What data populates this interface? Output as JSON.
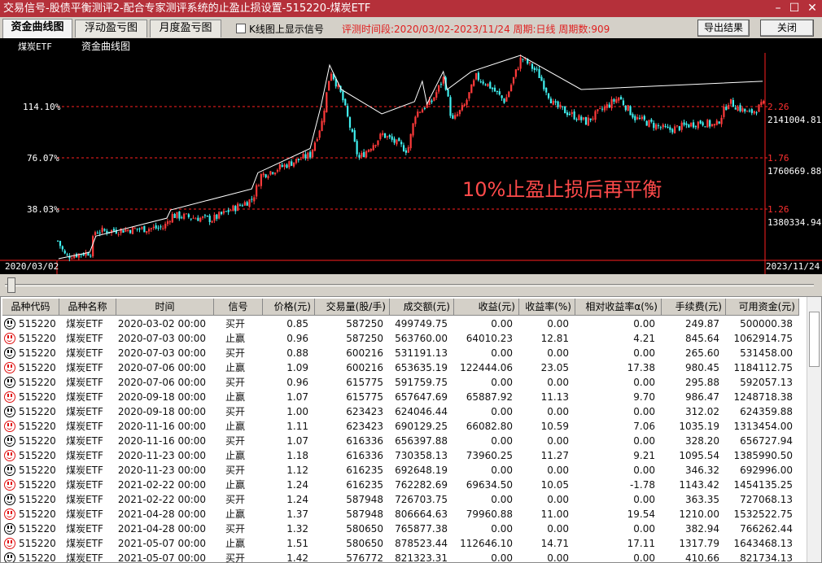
{
  "window": {
    "title": "交易信号-股债平衡测评2-配合专家测评系统的止盈止损设置-515220-煤炭ETF",
    "min": "–",
    "max": "☐",
    "close": "✕"
  },
  "toolbar": {
    "tabs": [
      "资金曲线图",
      "浮动盈亏图",
      "月度盈亏图"
    ],
    "checkbox_label": "K线图上显示信号",
    "checkbox_checked": false,
    "period_info": "评测时间段:2020/03/02-2023/11/24  周期:日线  周期数:909",
    "export_label": "导出结果",
    "close_label": "关闭"
  },
  "chart_data": {
    "type": "line",
    "security_label": "煤炭ETF",
    "title": "资金曲线图",
    "annotation": "10%止盈止损后再平衡",
    "start_date": "2020/03/02",
    "end_date": "2023/11/24",
    "bar_count": 909,
    "left_ticks": [
      "114.10%",
      "76.07%",
      "38.03%"
    ],
    "left_tick_values": [
      114.1,
      76.07,
      38.03
    ],
    "price_ticks": [
      "2.26",
      "1.76",
      "1.26"
    ],
    "price_tick_values": [
      2.26,
      1.76,
      1.26
    ],
    "equity_ticks": [
      "2141004.81",
      "1760669.88",
      "1380334.94"
    ],
    "colors": {
      "up": "#ff3a3a",
      "down": "#40f0f0",
      "equity": "#ffffff",
      "grid": "#ff2020"
    },
    "price_series": [
      [
        2,
        0.92
      ],
      [
        10,
        0.8
      ],
      [
        42,
        0.84
      ],
      [
        47,
        1.04
      ],
      [
        136,
        1.08
      ],
      [
        146,
        1.2
      ],
      [
        198,
        1.16
      ],
      [
        250,
        1.36
      ],
      [
        261,
        1.59
      ],
      [
        324,
        1.79
      ],
      [
        339,
        2.11
      ],
      [
        350,
        2.62
      ],
      [
        365,
        2.35
      ],
      [
        386,
        1.75
      ],
      [
        417,
        1.99
      ],
      [
        449,
        1.83
      ],
      [
        459,
        2.19
      ],
      [
        480,
        2.31
      ],
      [
        496,
        2.55
      ],
      [
        506,
        2.11
      ],
      [
        522,
        2.27
      ],
      [
        537,
        2.55
      ],
      [
        553,
        2.47
      ],
      [
        574,
        2.31
      ],
      [
        595,
        2.74
      ],
      [
        616,
        2.59
      ],
      [
        637,
        2.27
      ],
      [
        678,
        2.11
      ],
      [
        720,
        2.35
      ],
      [
        741,
        2.15
      ],
      [
        783,
        2.03
      ],
      [
        825,
        2.11
      ],
      [
        845,
        2.07
      ],
      [
        861,
        2.31
      ],
      [
        887,
        2.19
      ],
      [
        906,
        2.28
      ]
    ],
    "equity_pct_series": [
      [
        2,
        1.2
      ],
      [
        42,
        6
      ],
      [
        50,
        18
      ],
      [
        141,
        31.3
      ],
      [
        146,
        37.4
      ],
      [
        250,
        53
      ],
      [
        258,
        65
      ],
      [
        325,
        83
      ],
      [
        339,
        114.7
      ],
      [
        350,
        144.9
      ],
      [
        365,
        126.8
      ],
      [
        417,
        108.7
      ],
      [
        459,
        117.8
      ],
      [
        469,
        132.9
      ],
      [
        475,
        116
      ],
      [
        496,
        140.1
      ],
      [
        501,
        126.8
      ],
      [
        532,
        140.1
      ],
      [
        595,
        152.1
      ],
      [
        673,
        126.8
      ],
      [
        906,
        132.9
      ]
    ]
  },
  "table": {
    "columns": [
      "品种代码",
      "品种名称",
      "时间",
      "信号",
      "价格(元)",
      "交易量(股/手)",
      "成交额(元)",
      "收益(元)",
      "收益率(%)",
      "相对收益率α(%)",
      "手续费(元)",
      "可用资金(元)"
    ],
    "rows": [
      [
        "515220",
        "煤炭ETF",
        "2020-03-02 00:00",
        "买开",
        "0.85",
        "587250",
        "499749.75",
        "0.00",
        "0.00",
        "0.00",
        "249.87",
        "500000.38"
      ],
      [
        "515220",
        "煤炭ETF",
        "2020-07-03 00:00",
        "止赢",
        "0.96",
        "587250",
        "563760.00",
        "64010.23",
        "12.81",
        "4.21",
        "845.64",
        "1062914.75"
      ],
      [
        "515220",
        "煤炭ETF",
        "2020-07-03 00:00",
        "买开",
        "0.88",
        "600216",
        "531191.13",
        "0.00",
        "0.00",
        "0.00",
        "265.60",
        "531458.00"
      ],
      [
        "515220",
        "煤炭ETF",
        "2020-07-06 00:00",
        "止赢",
        "1.09",
        "600216",
        "653635.19",
        "122444.06",
        "23.05",
        "17.38",
        "980.45",
        "1184112.75"
      ],
      [
        "515220",
        "煤炭ETF",
        "2020-07-06 00:00",
        "买开",
        "0.96",
        "615775",
        "591759.75",
        "0.00",
        "0.00",
        "0.00",
        "295.88",
        "592057.13"
      ],
      [
        "515220",
        "煤炭ETF",
        "2020-09-18 00:00",
        "止赢",
        "1.07",
        "615775",
        "657647.69",
        "65887.92",
        "11.13",
        "9.70",
        "986.47",
        "1248718.38"
      ],
      [
        "515220",
        "煤炭ETF",
        "2020-09-18 00:00",
        "买开",
        "1.00",
        "623423",
        "624046.44",
        "0.00",
        "0.00",
        "0.00",
        "312.02",
        "624359.88"
      ],
      [
        "515220",
        "煤炭ETF",
        "2020-11-16 00:00",
        "止赢",
        "1.11",
        "623423",
        "690129.25",
        "66082.80",
        "10.59",
        "7.06",
        "1035.19",
        "1313454.00"
      ],
      [
        "515220",
        "煤炭ETF",
        "2020-11-16 00:00",
        "买开",
        "1.07",
        "616336",
        "656397.88",
        "0.00",
        "0.00",
        "0.00",
        "328.20",
        "656727.94"
      ],
      [
        "515220",
        "煤炭ETF",
        "2020-11-23 00:00",
        "止赢",
        "1.18",
        "616336",
        "730358.13",
        "73960.25",
        "11.27",
        "9.21",
        "1095.54",
        "1385990.50"
      ],
      [
        "515220",
        "煤炭ETF",
        "2020-11-23 00:00",
        "买开",
        "1.12",
        "616235",
        "692648.19",
        "0.00",
        "0.00",
        "0.00",
        "346.32",
        "692996.00"
      ],
      [
        "515220",
        "煤炭ETF",
        "2021-02-22 00:00",
        "止赢",
        "1.24",
        "616235",
        "762282.69",
        "69634.50",
        "10.05",
        "-1.78",
        "1143.42",
        "1454135.25"
      ],
      [
        "515220",
        "煤炭ETF",
        "2021-02-22 00:00",
        "买开",
        "1.24",
        "587948",
        "726703.75",
        "0.00",
        "0.00",
        "0.00",
        "363.35",
        "727068.13"
      ],
      [
        "515220",
        "煤炭ETF",
        "2021-04-28 00:00",
        "止赢",
        "1.37",
        "587948",
        "806664.63",
        "79960.88",
        "11.00",
        "19.54",
        "1210.00",
        "1532522.75"
      ],
      [
        "515220",
        "煤炭ETF",
        "2021-04-28 00:00",
        "买开",
        "1.32",
        "580650",
        "765877.38",
        "0.00",
        "0.00",
        "0.00",
        "382.94",
        "766262.44"
      ],
      [
        "515220",
        "煤炭ETF",
        "2021-05-07 00:00",
        "止赢",
        "1.51",
        "580650",
        "878523.44",
        "112646.10",
        "14.71",
        "17.11",
        "1317.79",
        "1643468.13"
      ],
      [
        "515220",
        "煤炭ETF",
        "2021-05-07 00:00",
        "买开",
        "1.42",
        "576772",
        "821323.31",
        "0.00",
        "0.00",
        "0.00",
        "410.66",
        "821734.13"
      ]
    ]
  }
}
